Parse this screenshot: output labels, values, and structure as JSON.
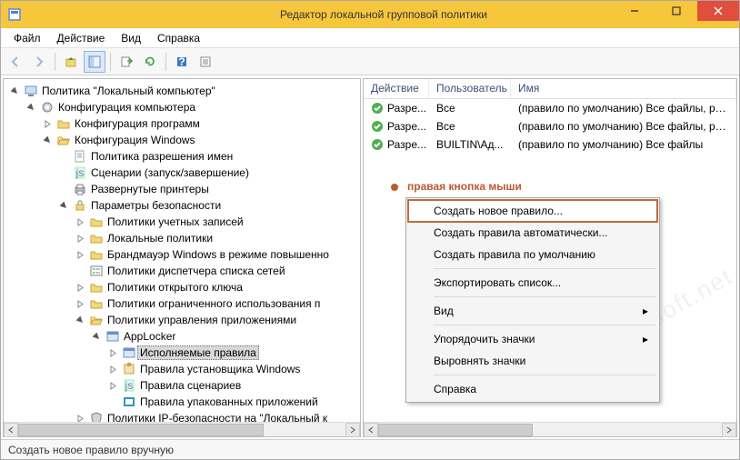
{
  "window": {
    "title": "Редактор локальной групповой политики"
  },
  "menus": {
    "file": "Файл",
    "action": "Действие",
    "view": "Вид",
    "help": "Справка"
  },
  "tree": {
    "root": "Политика \"Локальный компьютер\"",
    "node_comp_conf": "Конфигурация компьютера",
    "node_prog_conf": "Конфигурация программ",
    "node_win_conf": "Конфигурация Windows",
    "node_name_res": "Политика разрешения имен",
    "node_scripts": "Сценарии (запуск/завершение)",
    "node_printers": "Развернутые принтеры",
    "node_sec": "Параметры безопасности",
    "node_acct": "Политики учетных записей",
    "node_local": "Локальные политики",
    "node_fw": "Брандмауэр Windows в режиме повышенно",
    "node_netlist": "Политики диспетчера списка сетей",
    "node_pubkey": "Политики открытого ключа",
    "node_srp": "Политики ограниченного использования п",
    "node_appctrl": "Политики управления приложениями",
    "node_applocker": "AppLocker",
    "node_exe": "Исполняемые правила",
    "node_msi": "Правила установщика Windows",
    "node_script_rules": "Правила сценариев",
    "node_packaged": "Правила упакованных приложений",
    "node_ipsec": "Политики IP-безопасности на \"Локальный к"
  },
  "list": {
    "columns": {
      "action": "Действие",
      "user": "Пользователь",
      "name": "Имя"
    },
    "rows": [
      {
        "action": "Разре...",
        "user": "Все",
        "name": "(правило по умолчанию) Все файлы, располож"
      },
      {
        "action": "Разре...",
        "user": "Все",
        "name": "(правило по умолчанию) Все файлы, располож"
      },
      {
        "action": "Разре...",
        "user": "BUILTIN\\Ад...",
        "name": "(правило по умолчанию) Все файлы"
      }
    ]
  },
  "annotation": "правая кнопка мыши",
  "ctx": {
    "new_rule": "Создать новое правило...",
    "auto_rules": "Создать правила автоматически...",
    "default_rules": "Создать правила по умолчанию",
    "export": "Экспортировать список...",
    "view": "Вид",
    "arrange": "Упорядочить значки",
    "align": "Выровнять значки",
    "help": "Справка"
  },
  "status": "Создать новое правило вручную",
  "watermark": "www.spy-soft.net"
}
